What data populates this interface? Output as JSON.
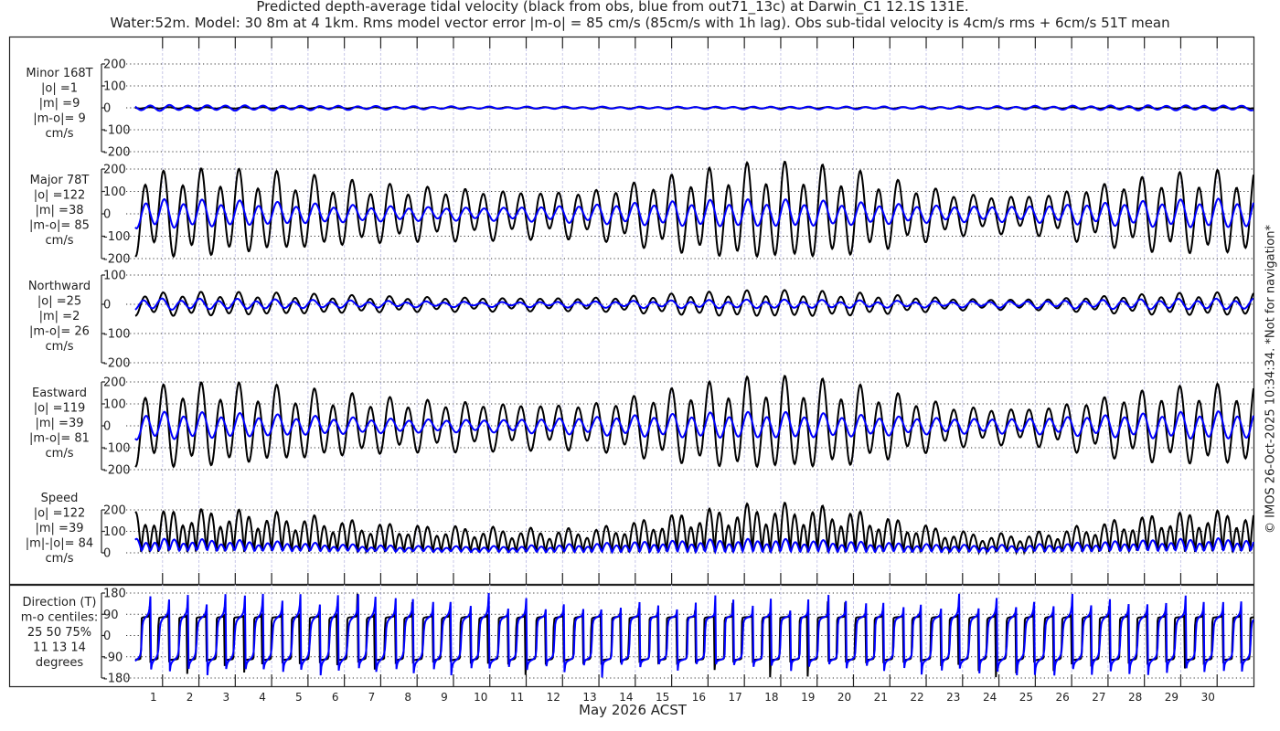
{
  "title": {
    "line1": "Predicted depth-average tidal velocity (black from obs, blue from out71_13c) at Darwin_C1 12.1S 131E.",
    "line2": "Water:52m. Model: 30 8m at 4 1km. Rms model vector error |m-o| = 85 cm/s (85cm/s with 1h lag). Obs sub-tidal velocity is 4cm/s rms + 6cm/s 51T mean"
  },
  "footer": "© IMOS 26-Oct-2025 10:34:34. *Not for navigation*",
  "colors": {
    "obs": "#000000",
    "model": "#0000ff",
    "grid": "#c8c8e8"
  },
  "chart_data": {
    "type": "line",
    "xlabel": "May 2026 ACST",
    "x_tick_labels": [
      "1",
      "2",
      "3",
      "4",
      "5",
      "6",
      "7",
      "8",
      "9",
      "10",
      "11",
      "12",
      "13",
      "14",
      "15",
      "16",
      "17",
      "18",
      "19",
      "20",
      "21",
      "22",
      "23",
      "24",
      "25",
      "26",
      "27",
      "28",
      "29",
      "30"
    ],
    "xlim_days": [
      0,
      31
    ],
    "series_legend": {
      "obs": "black from obs",
      "model": "blue from out71_13c"
    },
    "panels": [
      {
        "id": "minor",
        "label": [
          "Minor 168T",
          "|o| =1",
          "|m| =9",
          "|m-o|= 9",
          "cm/s"
        ],
        "yticks": [
          200,
          100,
          0,
          -100,
          -200
        ],
        "ylim": [
          -200,
          200
        ]
      },
      {
        "id": "major",
        "label": [
          "Major 78T",
          "|o| =122",
          "|m| =38",
          "|m-o|= 85",
          "cm/s"
        ],
        "yticks": [
          200,
          100,
          0,
          -100,
          -200
        ],
        "ylim": [
          -200,
          200
        ]
      },
      {
        "id": "north",
        "label": [
          "Northward",
          "|o| =25",
          "|m| =2",
          "|m-o|= 26",
          "cm/s"
        ],
        "yticks": [
          100,
          0,
          -100,
          -200
        ],
        "ylim": [
          -200,
          100
        ]
      },
      {
        "id": "east",
        "label": [
          "Eastward",
          "|o| =119",
          "|m| =39",
          "|m-o|= 81",
          "cm/s"
        ],
        "yticks": [
          200,
          100,
          0,
          -100,
          -200
        ],
        "ylim": [
          -200,
          200
        ]
      },
      {
        "id": "speed",
        "label": [
          "Speed",
          "|o| =122",
          "|m| =39",
          "|m|-|o|= 84",
          "cm/s"
        ],
        "yticks": [
          200,
          100,
          0
        ],
        "ylim": [
          0,
          200
        ]
      },
      {
        "id": "direction",
        "label": [
          "Direction (T)",
          "m-o centiles:",
          "25  50  75%",
          "11  13  14",
          "degrees"
        ],
        "yticks": [
          180,
          90,
          0,
          -90,
          -180
        ],
        "ylim": [
          -180,
          180
        ]
      }
    ],
    "daily_amplitude_obs_major": [
      190,
      200,
      205,
      200,
      190,
      175,
      155,
      140,
      130,
      125,
      120,
      115,
      112,
      120,
      150,
      180,
      205,
      225,
      230,
      220,
      200,
      165,
      130,
      100,
      90,
      95,
      120,
      150,
      175,
      190,
      195
    ],
    "daily_amplitude_model_major": [
      65,
      65,
      62,
      58,
      52,
      46,
      40,
      35,
      32,
      30,
      30,
      33,
      38,
      44,
      50,
      55,
      60,
      62,
      62,
      58,
      52,
      46,
      40,
      36,
      35,
      38,
      45,
      52,
      58,
      63,
      65
    ],
    "daily_amplitude_model_minor": [
      12,
      12,
      11,
      11,
      10,
      9,
      8,
      7,
      6,
      5,
      4,
      4,
      4,
      4,
      4,
      4,
      4,
      5,
      5,
      5,
      5,
      5,
      5,
      5,
      6,
      7,
      8,
      9,
      10,
      10,
      10
    ],
    "obs_minor_amplitude": 3,
    "major_axis_deg": 78
  }
}
